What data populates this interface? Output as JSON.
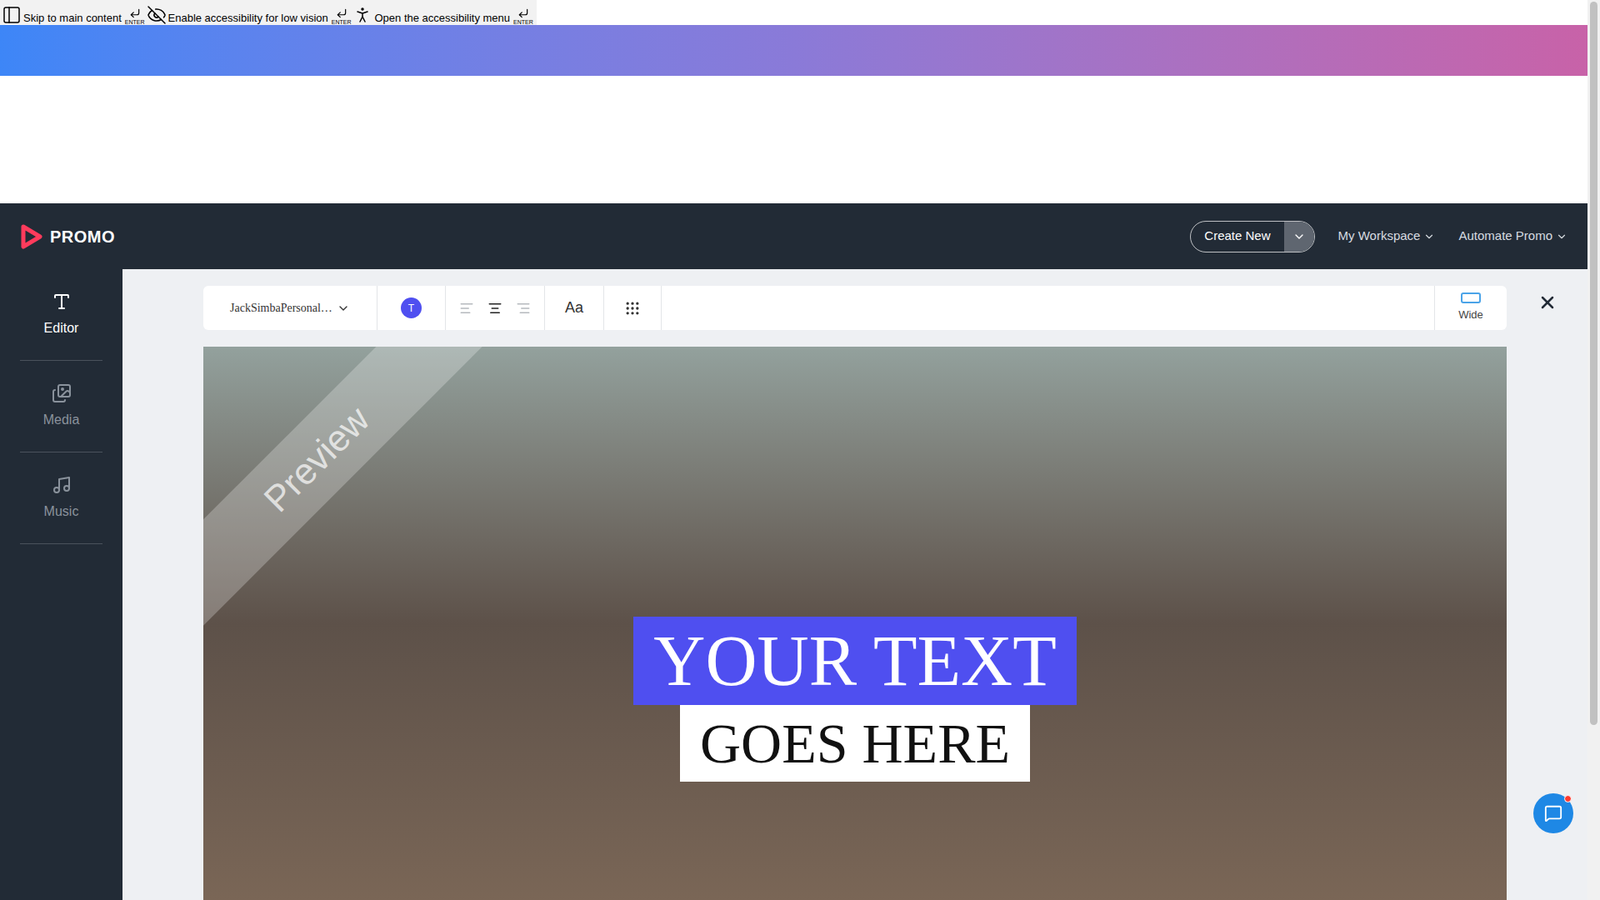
{
  "accessibility_bar": [
    {
      "label": "Skip to main content",
      "key": "ENTER"
    },
    {
      "label": "Enable accessibility for low vision",
      "key": "ENTER"
    },
    {
      "label": "Open the accessibility menu",
      "key": "ENTER"
    }
  ],
  "header": {
    "logo": "PROMO",
    "create_button": "Create New",
    "menus": [
      {
        "label": "My Workspace"
      },
      {
        "label": "Automate Promo"
      }
    ]
  },
  "sidebar": {
    "items": [
      {
        "label": "Editor",
        "selected": true
      },
      {
        "label": "Media",
        "selected": false
      },
      {
        "label": "Music",
        "selected": false
      }
    ]
  },
  "toolbar": {
    "font": "JackSimbaPersonal…",
    "color_button": "T",
    "color": "#4f4ff0",
    "alignments": [
      {
        "align": "left",
        "selected": false
      },
      {
        "align": "center",
        "selected": true
      },
      {
        "align": "right",
        "selected": false
      }
    ],
    "text_size": "Aa",
    "format": "Wide"
  },
  "canvas": {
    "watermark": "Preview",
    "lines": [
      {
        "text": "YOUR TEXT",
        "bg": "#4f4ff0",
        "color": "#ffffff"
      },
      {
        "text": "GOES HERE",
        "bg": "#ffffff",
        "color": "#111111"
      }
    ]
  }
}
